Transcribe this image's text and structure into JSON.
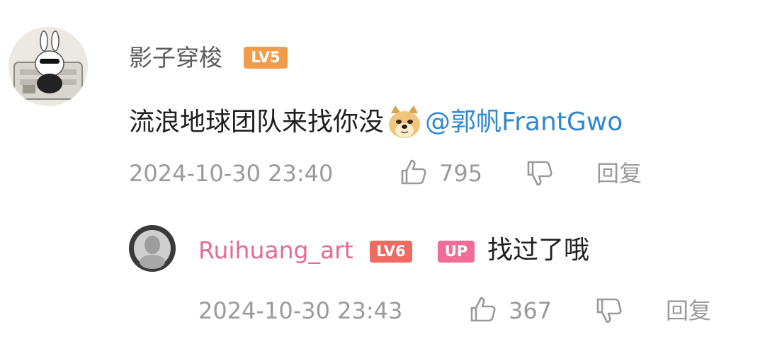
{
  "comment": {
    "username": "影子穿梭",
    "level": "LV5",
    "text": "流浪地球团队来找你没",
    "emoji": "doge-emoji",
    "mention": "@郭帆FrantGwo",
    "timestamp": "2024-10-30 23:40",
    "likes": "795",
    "reply_label": "回复"
  },
  "reply": {
    "username": "Ruihuang_art",
    "level": "LV6",
    "up_badge": "UP",
    "text": "找过了哦",
    "timestamp": "2024-10-30 23:43",
    "likes": "367",
    "reply_label": "回复"
  },
  "icons": {
    "like": "thumbs-up-icon",
    "dislike": "thumbs-down-icon"
  },
  "colors": {
    "mention": "#2f87cf",
    "up_username": "#e56a91",
    "level5": "#f29b4a",
    "level6": "#ee6a62",
    "up_badge": "#ef6d97",
    "meta_gray": "#9a9a9a"
  }
}
